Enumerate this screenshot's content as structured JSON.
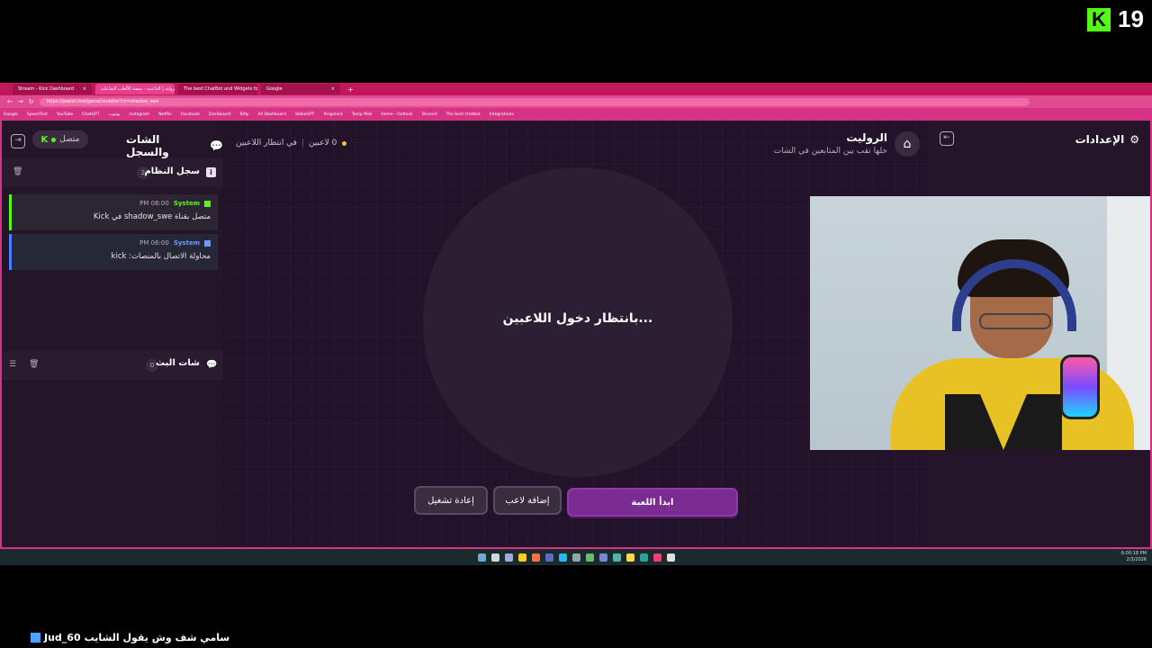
{
  "overlay": {
    "kick_logo": "K",
    "viewer_count": "19"
  },
  "browser": {
    "tabs": [
      {
        "label": "Stream - Kick Dashboard",
        "active": false
      },
      {
        "label": "الرولية | الداعمة - منصة الألعاب التفاعلية",
        "active": true
      },
      {
        "label": "The best ChatBot and Widgets for...",
        "active": false
      },
      {
        "label": "Google",
        "active": false
      }
    ],
    "url": "https://jawlet.live/game/roulette?ch=shadow_swe",
    "bookmarks": [
      "Google",
      "SpeedTest",
      "YouTube",
      "ChatGPT",
      "يوتيوب",
      "instagram",
      "Netflix",
      "Facebook",
      "Dashboard",
      "Bitly",
      "All Dashboard",
      "StakeGPT",
      "Pergolant",
      "Temp Mail",
      "Home - Outlook",
      "Discord",
      "The best chatbot",
      "Integrations"
    ]
  },
  "settings_panel": {
    "title": "الإعدادات"
  },
  "game": {
    "title": "الروليت",
    "subtitle": "خلها تقب بين المتابعين في الشات",
    "players_count": "0 لاعبين",
    "status": "في انتظار اللاعبين",
    "wheel_text": "بانتظار دخول اللاعبين...",
    "buttons": {
      "start": "ابدأ اللعبة",
      "add_player": "إضافة لاعب",
      "reset": "إعادة تشغيل"
    }
  },
  "chat_panel": {
    "title": "الشات والسجل",
    "status": "متصل",
    "platform_icon": "K",
    "system_log": {
      "title": "سجل النظام",
      "count": "2",
      "messages": [
        {
          "sender": "System",
          "time": "06:00 PM",
          "text": "متصل بقناة shadow_swe في Kick",
          "platform": "kick"
        },
        {
          "sender": "System",
          "time": "06:00 PM",
          "text": "محاولة الاتصال بالمنصات: kick",
          "platform": "system"
        }
      ]
    },
    "stream_chat": {
      "title": "شات البث",
      "count": "0"
    }
  },
  "taskbar": {
    "time": "6:00:18 PM",
    "date": "2/3/2026"
  },
  "stream_chat_overlay": {
    "username": "Jud_60",
    "message": "سامي شف وش يقول الشايب"
  },
  "colors": {
    "kick_green": "#53fc18",
    "browser_pink": "#d63384",
    "accent_purple": "#7a2c93",
    "app_bg": "#1f1224"
  }
}
